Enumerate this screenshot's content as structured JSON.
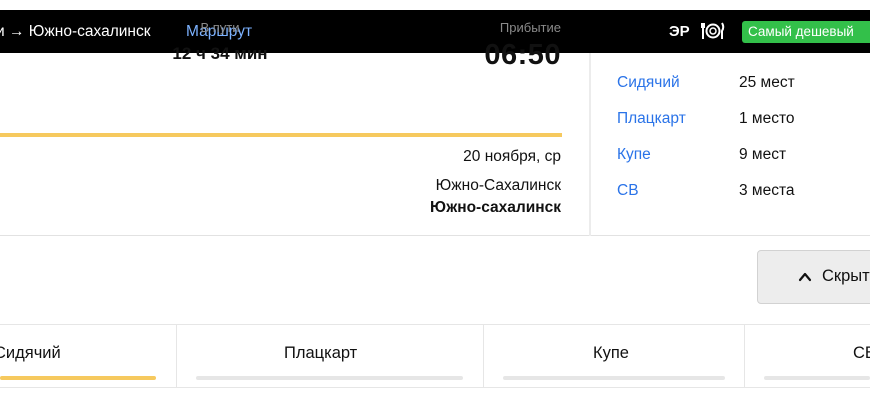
{
  "header": {
    "route": "и → Южно-сахалинск",
    "route_link": "Маршрут",
    "train_class": "ЭР",
    "cheapest_badge": "Самый дешевый"
  },
  "trip": {
    "travel_label": "В пути",
    "travel_time": "12 ч 34 мин",
    "arrival_label": "Прибытие",
    "arrival_time": "06:50",
    "arrival_date": "20 ноября, ср",
    "arrival_city": "Южно-Сахалинск",
    "arrival_station": "Южно-сахалинск"
  },
  "seats": [
    {
      "type": "Сидячий",
      "count": "25 мест"
    },
    {
      "type": "Плацкарт",
      "count": "1 место"
    },
    {
      "type": "Купе",
      "count": "9 мест"
    },
    {
      "type": "СВ",
      "count": "3 места"
    }
  ],
  "hide_button": {
    "label": "Скрыть"
  },
  "tabs": [
    {
      "label": "Сидячий",
      "active": true
    },
    {
      "label": "Плацкарт",
      "active": false
    },
    {
      "label": "Купе",
      "active": false
    },
    {
      "label": "СВ",
      "active": false
    }
  ],
  "colors": {
    "accent_yellow": "#f6c95e",
    "link_blue": "#2a73e8",
    "badge_green": "#33c04a"
  },
  "icons": {
    "meal": "fork-plate-knife-icon",
    "chevron": "chevron-up-icon"
  }
}
